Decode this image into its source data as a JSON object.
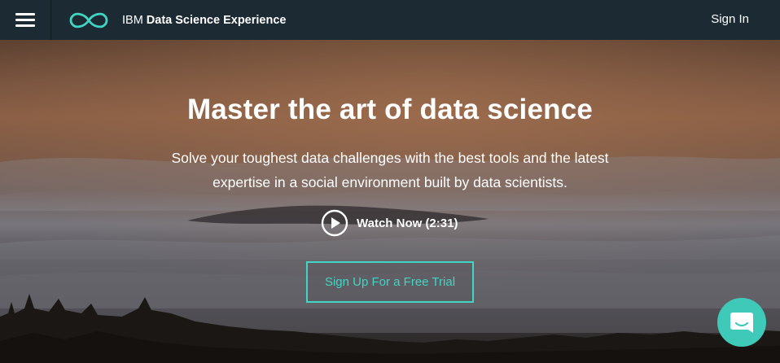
{
  "header": {
    "brand_prefix": "IBM",
    "brand_name": "Data Science Experience",
    "sign_in_label": "Sign In",
    "menu_icon": "hamburger-menu-icon",
    "logo_icon": "infinity-logo-icon"
  },
  "hero": {
    "title": "Master the art of data science",
    "subtitle": "Solve your toughest data challenges with the best tools and the latest expertise in a social environment built by data scientists.",
    "watch_label": "Watch Now (2:31)",
    "watch_icon": "play-circle-icon",
    "cta_label": "Sign Up For a Free Trial"
  },
  "chat": {
    "icon": "chat-bubble-icon"
  },
  "colors": {
    "header_bg": "#1c2a33",
    "accent": "#41d6c3",
    "chat_bg": "#3ec9b8",
    "text": "#ffffff"
  }
}
